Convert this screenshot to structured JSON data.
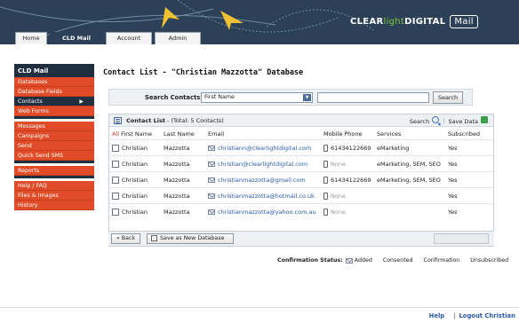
{
  "brand": {
    "clear": "CLEAR",
    "light": "light",
    "digital": "DIGITAL",
    "mail": "Mail"
  },
  "tabs": [
    "Home",
    "CLD Mail",
    "Account",
    "Admin"
  ],
  "sidebar": {
    "heading": "CLD Mail",
    "group1": [
      "Databases",
      "Database Fields",
      "Contacts",
      "Web Forms"
    ],
    "group2": [
      "Messages",
      "Campaigns",
      "Send",
      "Quick Send SMS"
    ],
    "group3": [
      "Reports"
    ],
    "group4": [
      "Help / FAQ",
      "Files & Images",
      "History"
    ]
  },
  "page_title": "Contact List - \"Christian Mazzotta\" Database",
  "search": {
    "label": "Search Contacts:",
    "field_value": "First Name",
    "input_value": "",
    "button": "Search"
  },
  "list": {
    "title": "Contact List",
    "total": "- (Total: 5 Contacts)",
    "search_link": "Search",
    "save_link": "Save Data",
    "columns": {
      "all": "All",
      "first": "First Name",
      "last": "Last Name",
      "email": "Email",
      "mobile": "Mobile Phone",
      "services": "Services",
      "subscribed": "Subscribed"
    },
    "rows": [
      {
        "first": "Christian",
        "last": "Mazzotta",
        "email": "christiann@clearlightdigital.com",
        "mobile": "61434122669",
        "services": "eMarketing",
        "subscribed": "Yes"
      },
      {
        "first": "Christian",
        "last": "Mazzotta",
        "email": "christian@clearlightdigital.com",
        "mobile": "None",
        "services": "eMarketing, SEM, SEO",
        "subscribed": "Yes"
      },
      {
        "first": "Christian",
        "last": "Mazzotta",
        "email": "christianmazzotta@gmail.com",
        "mobile": "61434122669",
        "services": "eMarketing, SEM, SEO",
        "subscribed": "Yes"
      },
      {
        "first": "Christian",
        "last": "Mazzotta",
        "email": "christianmazzotta@hotmail.co.uk",
        "mobile": "None",
        "services": "",
        "subscribed": "Yes"
      },
      {
        "first": "Christian",
        "last": "Mazzotta",
        "email": "christianmazzotta@yahoo.com.au",
        "mobile": "None",
        "services": "",
        "subscribed": "Yes"
      }
    ]
  },
  "buttons": {
    "back": "« Back",
    "save_db": "Save as New Database"
  },
  "legend": {
    "label": "Confirmation Status:",
    "added": "Added",
    "consented": "Consented",
    "confirmation": "Confirmation",
    "unsubscribed": "Unsubscribed"
  },
  "footer": {
    "help": "Help",
    "logout": "Logout Christian",
    "sep": "|"
  },
  "colors": {
    "header_bg": "#2c4158",
    "accent_orange": "#e14b27",
    "accent_green": "#7fc63a",
    "link_blue": "#2a5aa8"
  }
}
